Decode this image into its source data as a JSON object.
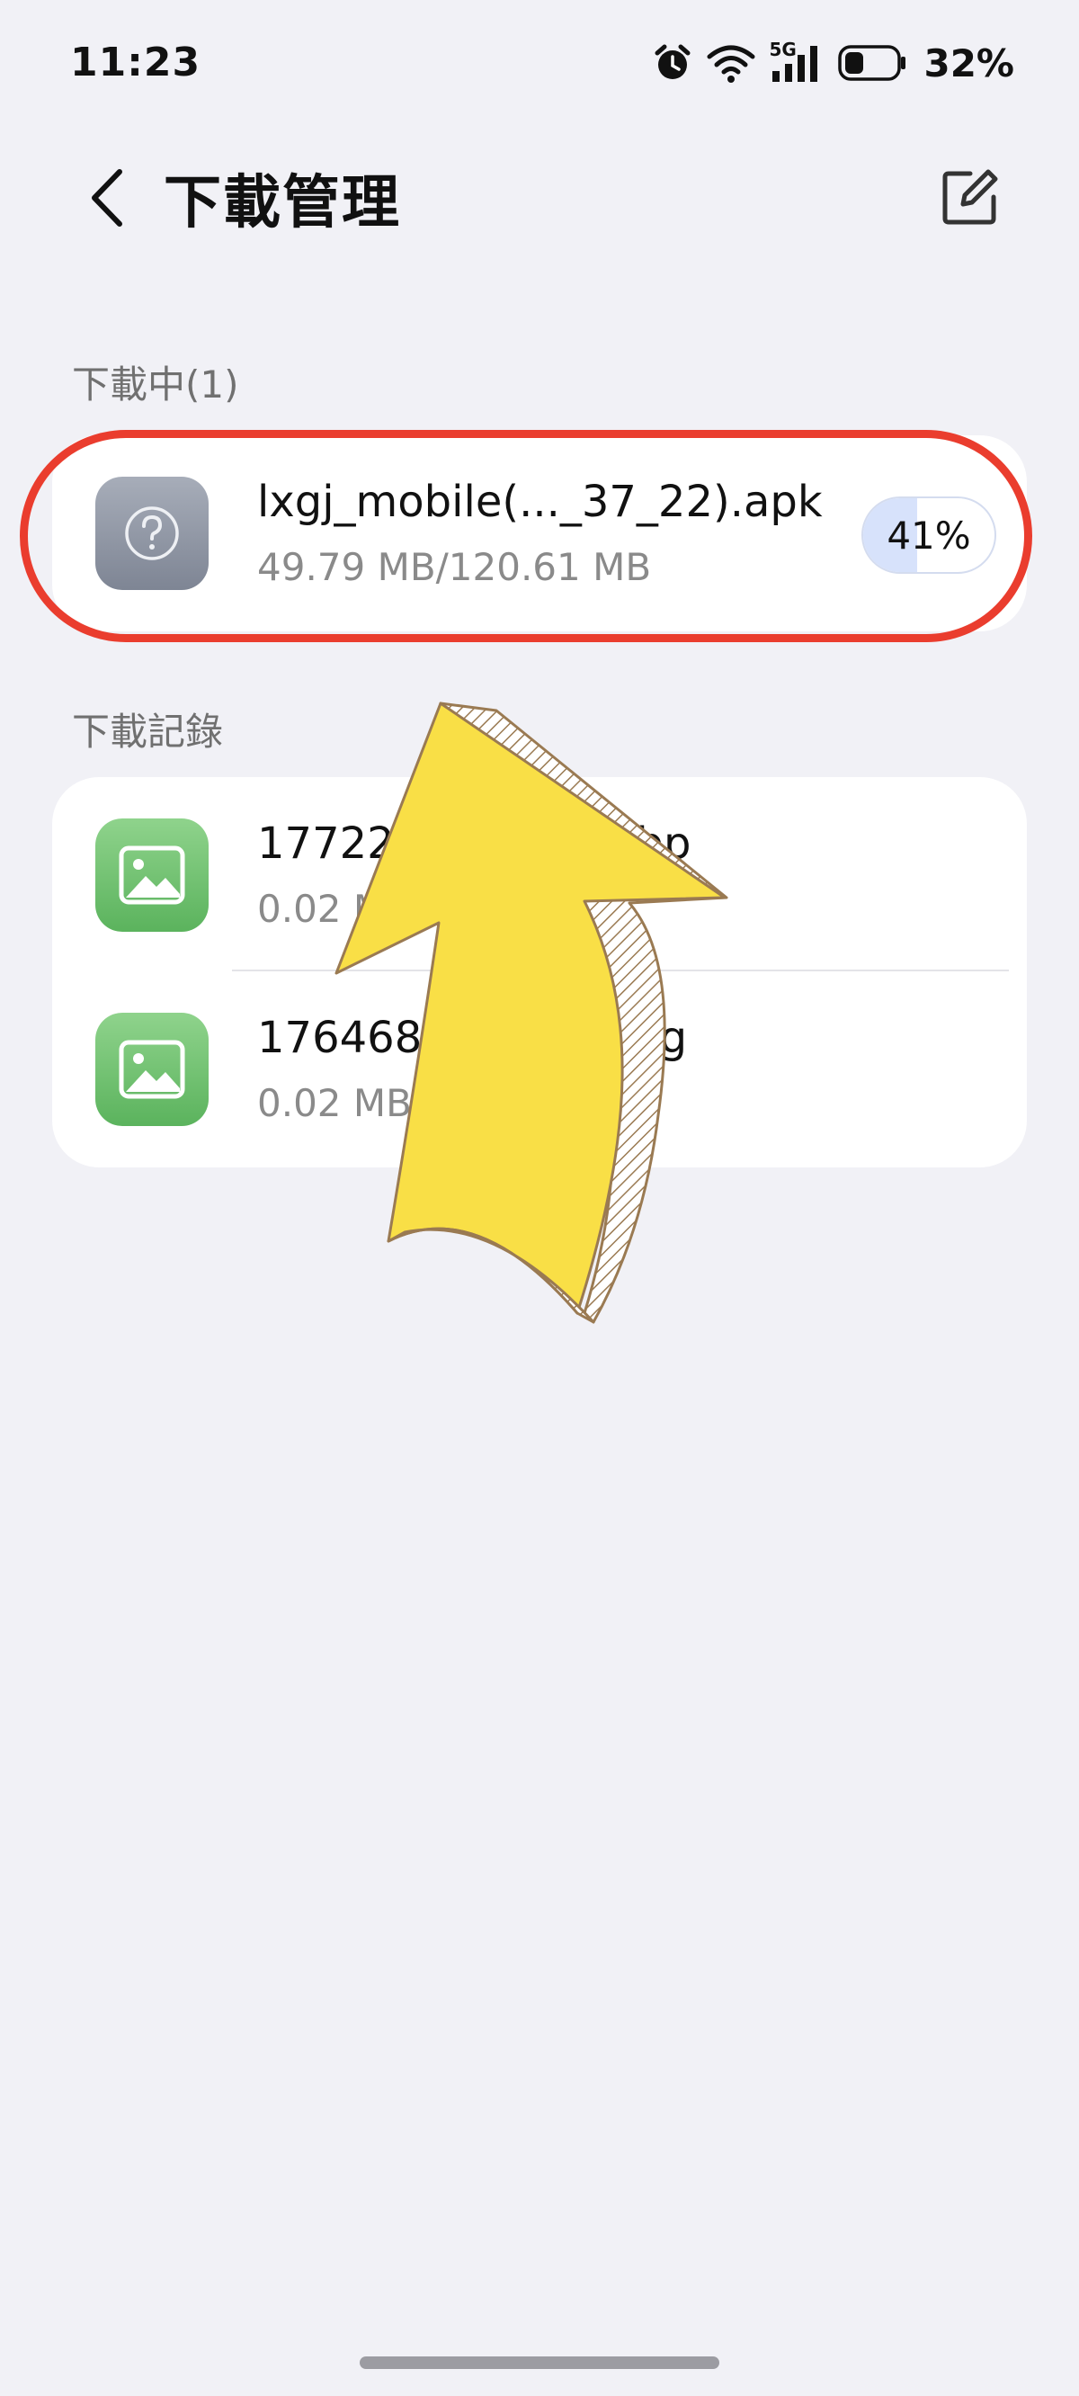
{
  "status_bar": {
    "time": "11:23",
    "network_label": "5G",
    "battery_percent_text": "32%",
    "battery_level": 0.32,
    "icons": [
      "alarm-icon",
      "wifi-icon",
      "cellular-signal-icon",
      "battery-icon"
    ]
  },
  "header": {
    "title": "下載管理",
    "back_icon": "chevron-left-icon",
    "edit_icon": "edit-icon"
  },
  "downloading": {
    "section_label": "下載中(1)",
    "items": [
      {
        "name": "lxgj_mobile(..._37_22).apk",
        "size": "49.79 MB/120.61 MB",
        "progress_text": "41%",
        "progress": 0.41,
        "icon": "unknown-file-icon"
      }
    ]
  },
  "history": {
    "section_label": "下載記錄",
    "items": [
      {
        "name": "17722",
        "name_suffix": "webp",
        "size": "0.02 M",
        "icon": "image-file-icon"
      },
      {
        "name": "1764688",
        "name_suffix": "jpg",
        "size": "0.02 MB",
        "icon": "image-file-icon"
      }
    ]
  },
  "annotation": {
    "highlight_color": "#ea3d2e",
    "arrow_color": "#f9df46",
    "arrow_direction": "up"
  },
  "colors": {
    "background": "#f1f1f6",
    "card": "#ffffff",
    "progress_fill": "#d7e2fb"
  }
}
